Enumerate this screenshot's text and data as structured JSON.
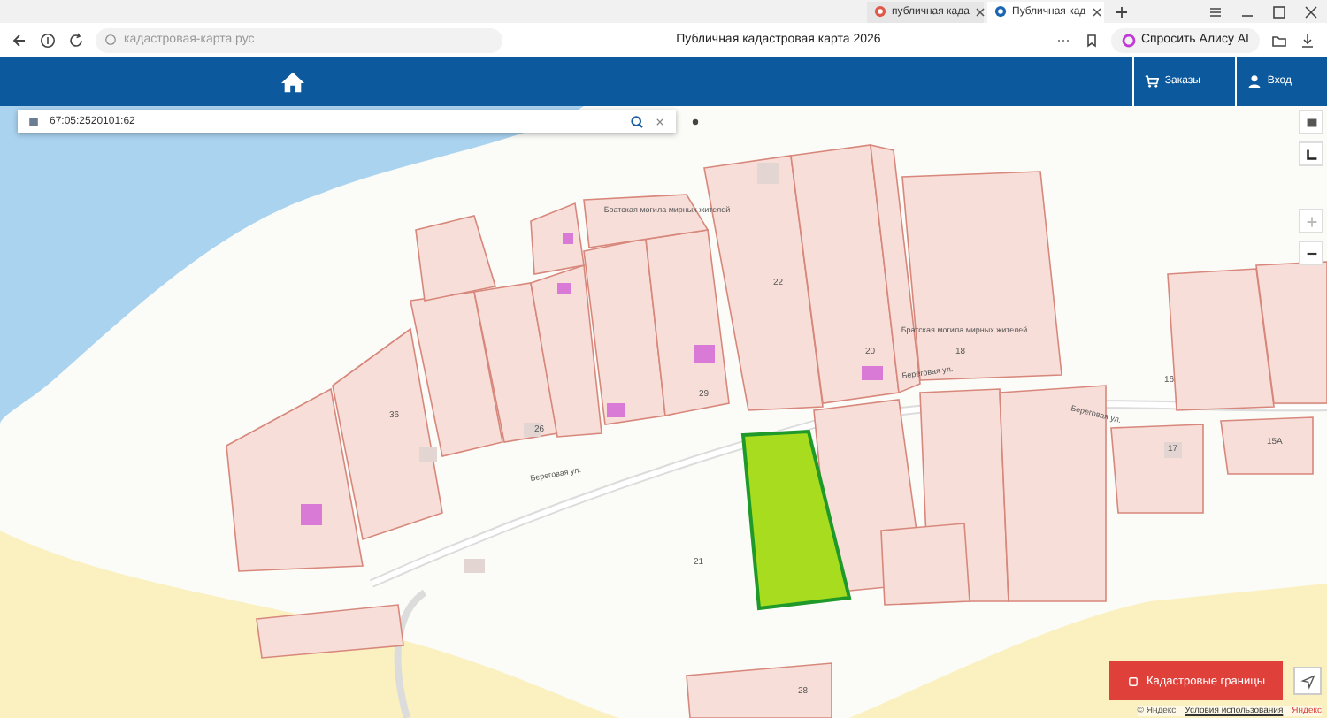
{
  "browser": {
    "tabs": [
      {
        "title": "публичная када",
        "selected": false
      },
      {
        "title": "Публичная кад",
        "selected": true
      }
    ],
    "address": "кадастровая-карта.рус",
    "page_title": "Публичная кадастровая карта 2026",
    "assistant_button": "Спросить Алису AI"
  },
  "header": {
    "nav": [
      {
        "label": "Заказы",
        "kind": "cart"
      },
      {
        "label": "Вход",
        "kind": "user"
      }
    ]
  },
  "search": {
    "value": "67:05:2520101:62"
  },
  "map": {
    "numbers": [
      "22",
      "20",
      "18",
      "16",
      "15А",
      "17",
      "36",
      "21",
      "26",
      "28",
      "29"
    ],
    "streets": [
      "Береговая ул.",
      "Береговая ул.",
      "Береговая ул."
    ],
    "memorials": [
      {
        "name": "Братская могила мирных жителей"
      },
      {
        "name": "Братская могила мирных жителей"
      }
    ]
  },
  "cadastre_button": "Кадастровые границы",
  "attribution": {
    "provider": "© Яндекс",
    "terms": "Условия использования",
    "brand": "Яндекс"
  }
}
